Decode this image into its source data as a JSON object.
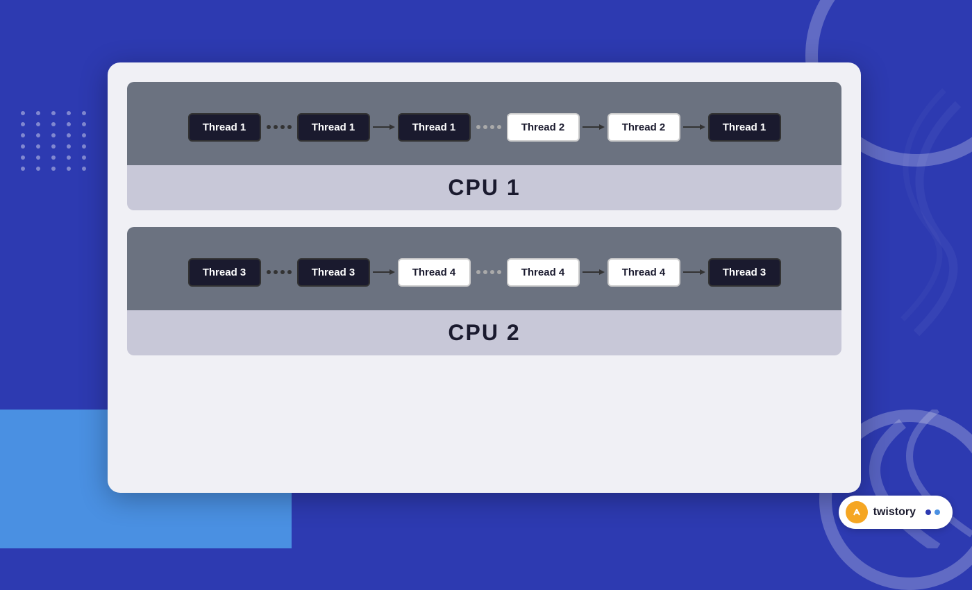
{
  "background": {
    "main_color": "#2d3ab1"
  },
  "cpu1": {
    "label": "CPU 1",
    "threads": [
      {
        "text": "Thread 1",
        "style": "dark"
      },
      {
        "connector": "dots"
      },
      {
        "text": "Thread 1",
        "style": "dark"
      },
      {
        "connector": "arrow"
      },
      {
        "text": "Thread 1",
        "style": "dark"
      },
      {
        "connector": "dots-light"
      },
      {
        "text": "Thread 2",
        "style": "light"
      },
      {
        "connector": "arrow"
      },
      {
        "text": "Thread 2",
        "style": "light"
      },
      {
        "connector": "arrow"
      },
      {
        "text": "Thread 1",
        "style": "dark"
      }
    ]
  },
  "cpu2": {
    "label": "CPU 2",
    "threads": [
      {
        "text": "Thread 3",
        "style": "dark"
      },
      {
        "connector": "dots"
      },
      {
        "text": "Thread 3",
        "style": "dark"
      },
      {
        "connector": "arrow"
      },
      {
        "text": "Thread 4",
        "style": "light"
      },
      {
        "connector": "dots-light"
      },
      {
        "text": "Thread 4",
        "style": "light"
      },
      {
        "connector": "arrow"
      },
      {
        "text": "Thread 4",
        "style": "light"
      },
      {
        "connector": "arrow"
      },
      {
        "text": "Thread 3",
        "style": "dark"
      }
    ]
  },
  "branding": {
    "name": "twistory",
    "icon": "🎯"
  }
}
